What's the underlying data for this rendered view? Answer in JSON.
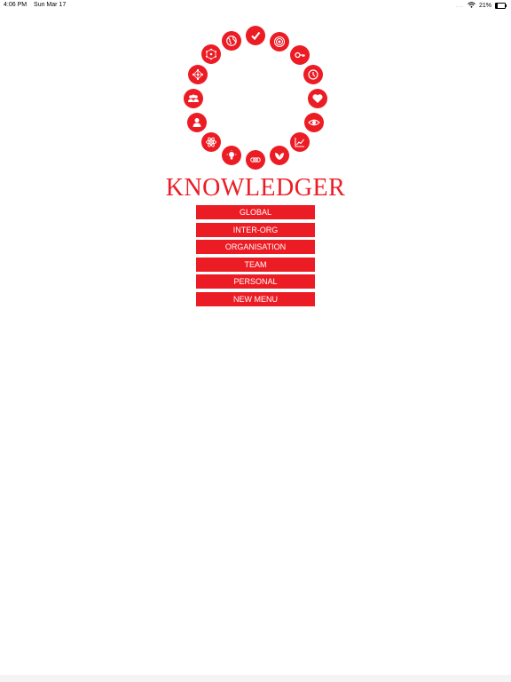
{
  "status_bar": {
    "time": "4:06 PM",
    "date": "Sun Mar 17",
    "more": "...",
    "battery_text": "21%",
    "battery_level": 0.21,
    "wifi_icon": "wifi-icon"
  },
  "app": {
    "title": "KNOWLEDGER"
  },
  "icons": [
    "check-icon",
    "target-icon",
    "key-icon",
    "clock-icon",
    "heart-icon",
    "eye-icon",
    "chart-icon",
    "leaf-icon",
    "rings-icon",
    "bulb-icon",
    "atom-icon",
    "person-icon",
    "group-icon",
    "network-icon",
    "hexagon-icon",
    "globe-icon"
  ],
  "menu": {
    "items": [
      "GLOBAL",
      "INTER-ORG",
      "ORGANISATION",
      "TEAM",
      "PERSONAL",
      "NEW MENU"
    ]
  },
  "colors": {
    "accent": "#ec1c24",
    "background": "#ffffff"
  }
}
